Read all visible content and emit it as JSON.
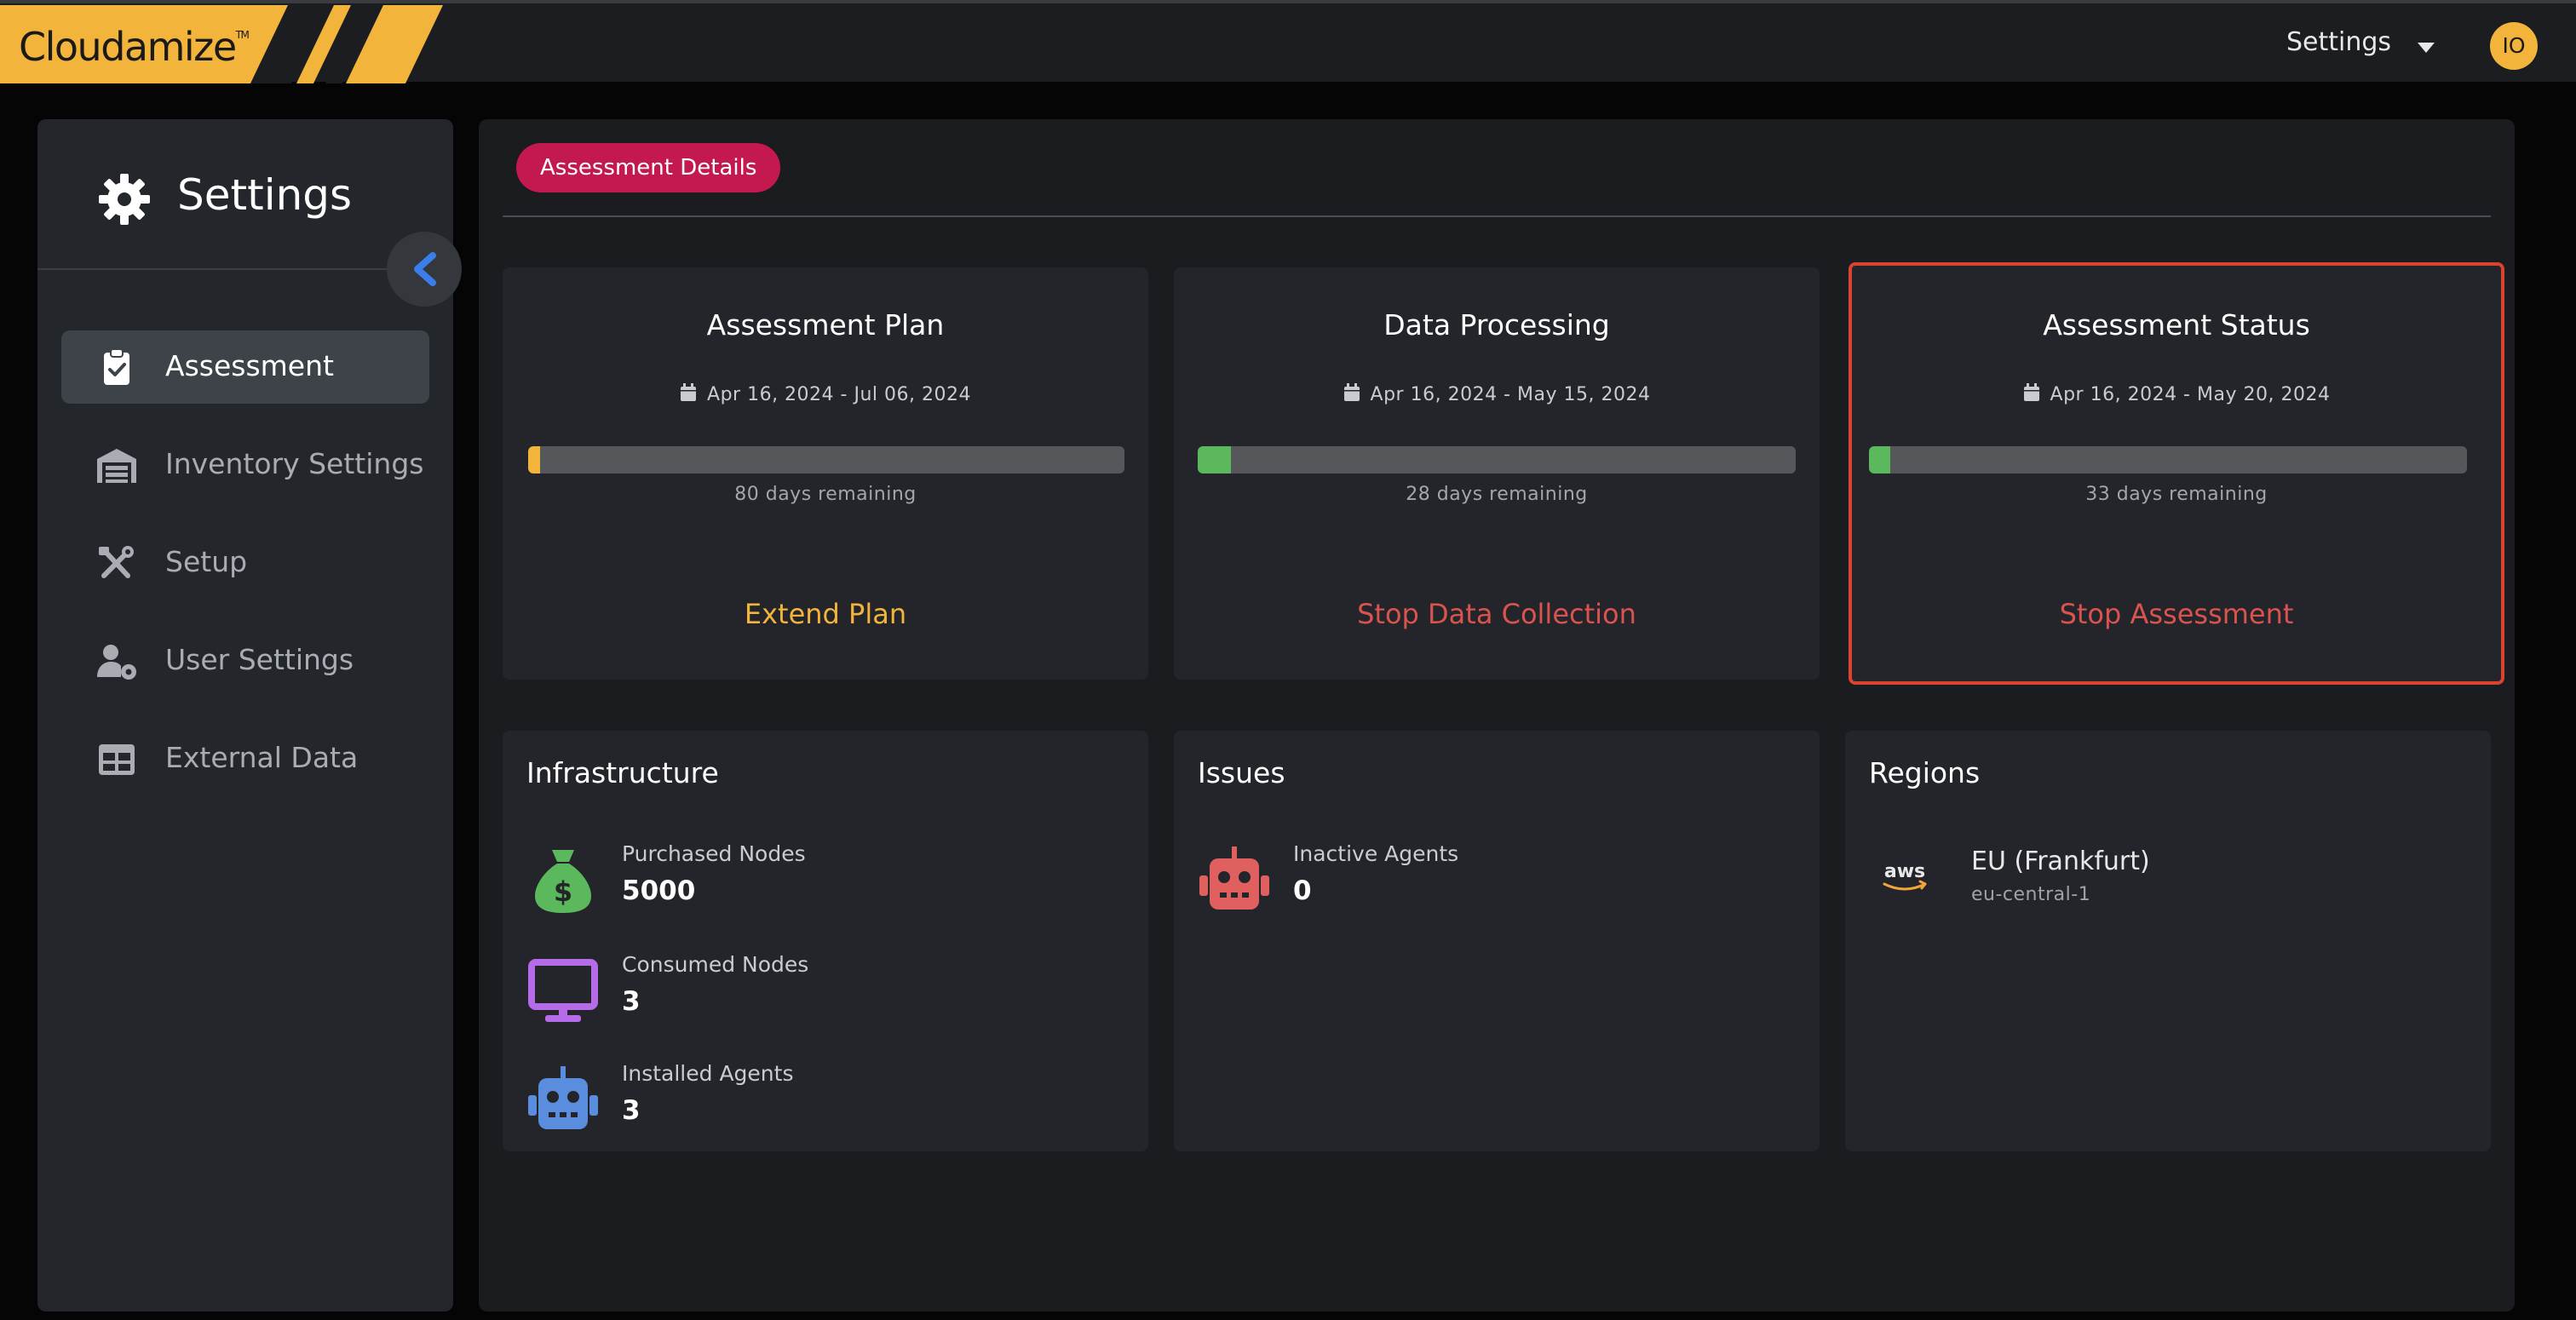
{
  "topbar": {
    "logo_text": "Cloudamize",
    "logo_tm": "TM",
    "settings_label": "Settings",
    "avatar_initials": "IO",
    "brand_color": "#f2b43a"
  },
  "sidebar": {
    "title": "Settings",
    "items": [
      {
        "label": "Assessment",
        "icon": "clipboard-check-icon",
        "active": true
      },
      {
        "label": "Inventory Settings",
        "icon": "warehouse-icon",
        "active": false
      },
      {
        "label": "Setup",
        "icon": "tools-icon",
        "active": false
      },
      {
        "label": "User Settings",
        "icon": "user-gear-icon",
        "active": false
      },
      {
        "label": "External Data",
        "icon": "table-icon",
        "active": false
      }
    ]
  },
  "main": {
    "tab_label": "Assessment Details",
    "cards": [
      {
        "title": "Assessment Plan",
        "date_range": "Apr 16, 2024 - Jul 06, 2024",
        "progress": 0.02,
        "progress_color": "#f2b43a",
        "remaining": "80 days remaining",
        "action": "Extend Plan",
        "action_color": "#f2b43a"
      },
      {
        "title": "Data Processing",
        "date_range": "Apr 16, 2024 - May 15, 2024",
        "progress": 0.055,
        "progress_color": "#5cb85c",
        "remaining": "28 days remaining",
        "action": "Stop Data Collection",
        "action_color": "#d9534f"
      },
      {
        "title": "Assessment Status",
        "date_range": "Apr 16, 2024 - May 20, 2024",
        "progress": 0.035,
        "progress_color": "#5cb85c",
        "remaining": "33 days remaining",
        "action": "Stop Assessment",
        "action_color": "#d9534f"
      }
    ],
    "infrastructure": {
      "title": "Infrastructure",
      "stats": [
        {
          "label": "Purchased Nodes",
          "value": "5000",
          "icon": "money-bag-icon",
          "color": "#5cb85c"
        },
        {
          "label": "Consumed Nodes",
          "value": "3",
          "icon": "monitor-icon",
          "color": "#b66be8"
        },
        {
          "label": "Installed Agents",
          "value": "3",
          "icon": "robot-icon",
          "color": "#5b8dde"
        }
      ]
    },
    "issues": {
      "title": "Issues",
      "stats": [
        {
          "label": "Inactive Agents",
          "value": "0",
          "icon": "robot-icon",
          "color": "#e06060"
        }
      ]
    },
    "regions": {
      "title": "Regions",
      "provider_logo": "aws",
      "name": "EU (Frankfurt)",
      "code": "eu-central-1"
    }
  }
}
